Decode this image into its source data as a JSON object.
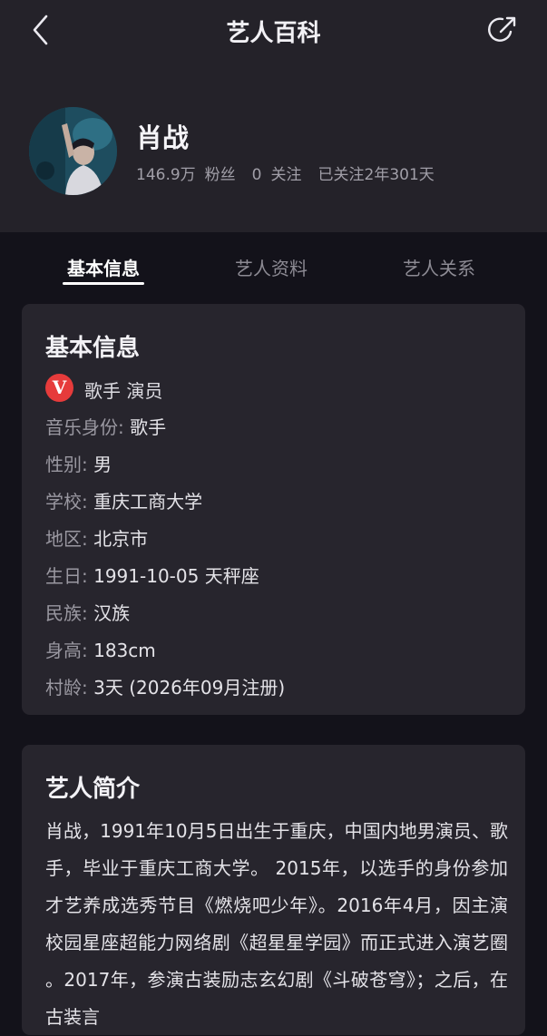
{
  "nav": {
    "title": "艺人百科",
    "back_icon": "chevron-left-icon",
    "share_icon": "share-icon"
  },
  "artist": {
    "name": "肖战",
    "fans_count": "146.9万",
    "fans_label": "粉丝",
    "following_count": "0",
    "following_label": "关注",
    "followed_since": "已关注2年301天"
  },
  "tabs": [
    {
      "label": "基本信息",
      "active": true
    },
    {
      "label": "艺人资料",
      "active": false
    },
    {
      "label": "艺人关系",
      "active": false
    }
  ],
  "basic_info": {
    "title": "基本信息",
    "badge_letter": "V",
    "badge_text": "歌手 演员",
    "rows": [
      {
        "label": "音乐身份:",
        "value": "歌手"
      },
      {
        "label": "性别:",
        "value": "男"
      },
      {
        "label": "学校:",
        "value": "重庆工商大学"
      },
      {
        "label": "地区:",
        "value": "北京市"
      },
      {
        "label": "生日:",
        "value": "1991-10-05 天秤座"
      },
      {
        "label": "民族:",
        "value": "汉族"
      },
      {
        "label": "身高:",
        "value": "183cm"
      },
      {
        "label": "村龄:",
        "value": "3天 (2026年09月注册)"
      }
    ]
  },
  "intro": {
    "title": "艺人简介",
    "text": "肖战，1991年10月5日出生于重庆，中国内地男演员、歌手，毕业于重庆工商大学。 2015年，以选手的身份参加才艺养成选秀节目《燃烧吧少年》。2016年4月，因主演校园星座超能力网络剧《超星星学园》而正式进入演艺圈 。2017年，参演古装励志玄幻剧《斗破苍穹》；之后，在古装言"
  },
  "colors": {
    "background": "#13121a",
    "header": "#242229",
    "card": "#27252d",
    "badge_red": "#e63b3b"
  }
}
